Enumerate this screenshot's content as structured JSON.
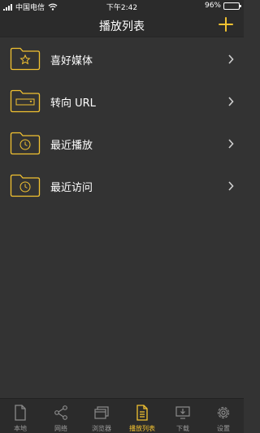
{
  "colors": {
    "accent": "#f2c231",
    "background": "#333333",
    "bar_background": "#2b2b2b",
    "inactive_icon": "#8a8a8a"
  },
  "status_bar": {
    "carrier": "中国电信",
    "time": "下午2:42",
    "battery": "96%",
    "battery_level": 0.96
  },
  "nav": {
    "title": "播放列表",
    "add_icon": "plus-icon"
  },
  "list": [
    {
      "label": "喜好媒体",
      "icon": "folder-star-icon"
    },
    {
      "label": "转向 URL",
      "icon": "folder-link-icon"
    },
    {
      "label": "最近播放",
      "icon": "folder-clock-icon"
    },
    {
      "label": "最近访问",
      "icon": "folder-clock-icon"
    }
  ],
  "tabs": [
    {
      "label": "本地",
      "icon": "document-icon",
      "active": false
    },
    {
      "label": "网络",
      "icon": "share-icon",
      "active": false
    },
    {
      "label": "浏览器",
      "icon": "windows-icon",
      "active": false
    },
    {
      "label": "播放列表",
      "icon": "playlist-icon",
      "active": true
    },
    {
      "label": "下载",
      "icon": "download-icon",
      "active": false
    },
    {
      "label": "设置",
      "icon": "gear-icon",
      "active": false
    }
  ]
}
